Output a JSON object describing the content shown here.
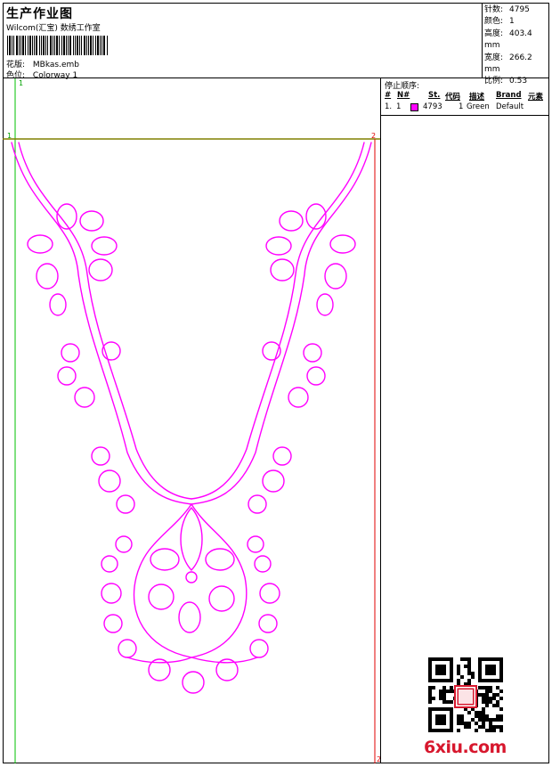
{
  "header": {
    "title": "生产作业图",
    "subtitle": "Wilcom(汇宝) 数绣工作室",
    "design_label": "花版:",
    "design_value": "MBkas.emb",
    "colorway_label": "色位:",
    "colorway_value": "Colorway 1"
  },
  "stats": [
    {
      "label": "针数:",
      "value": "4795"
    },
    {
      "label": "颜色:",
      "value": "1"
    },
    {
      "label": "高度:",
      "value": "403.4 mm"
    },
    {
      "label": "宽度:",
      "value": "266.2 mm"
    },
    {
      "label": "比例:",
      "value": "0.53"
    }
  ],
  "stops": {
    "title": "停止顺序:",
    "columns": [
      "#",
      "N#",
      "St.",
      "代码",
      "描述",
      "Brand",
      "元素"
    ],
    "rows": [
      {
        "index": "1.",
        "n": "1",
        "stitches": "4793",
        "code": "1",
        "description": "Green",
        "brand": "Default",
        "swatch_color": "#ff00ff"
      }
    ]
  },
  "canvas": {
    "marker_top_left": "1",
    "marker_left_mid": "1",
    "marker_right_mid": "2",
    "marker_bottom_right": "2",
    "thread_color": "#ff00ff",
    "guide_green": "#00c000",
    "guide_olive": "#808000",
    "guide_red": "#e00000"
  },
  "watermark": "6xiu.com"
}
